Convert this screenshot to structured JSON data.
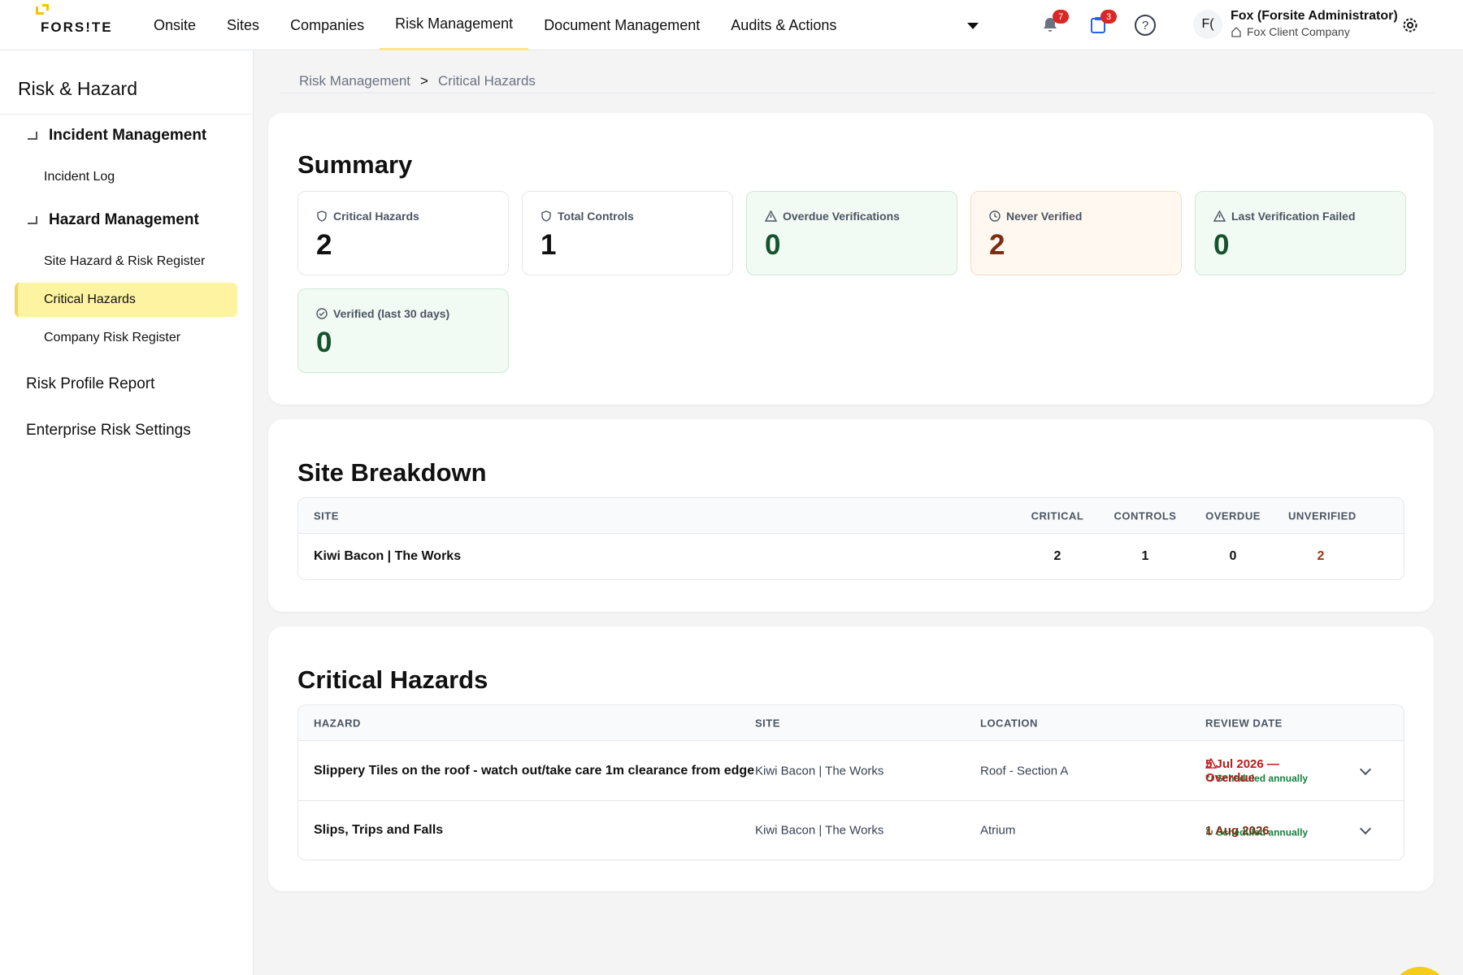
{
  "brand": {
    "logo_text": "FORS!TE"
  },
  "nav": {
    "items": [
      {
        "label": "Onsite"
      },
      {
        "label": "Sites"
      },
      {
        "label": "Companies"
      },
      {
        "label": "Risk Management"
      },
      {
        "label": "Document Management"
      },
      {
        "label": "Audits & Actions"
      }
    ],
    "active": "Risk Management"
  },
  "header": {
    "notifications_count": "7",
    "tasks_count": "3",
    "help_icon": "question-circle-icon",
    "avatar_initials": "F(",
    "user_name": "Fox (Forsite Administrator)",
    "user_company": "Fox Client Company"
  },
  "sidebar": {
    "title": "Risk & Hazard",
    "group_incident": "Incident Management",
    "incident_log": "Incident Log",
    "group_hazard": "Hazard Management",
    "site_hazard_register": "Site Hazard & Risk Register",
    "critical_hazards": "Critical Hazards",
    "company_risk_register": "Company Risk Register",
    "risk_profile_report": "Risk Profile Report",
    "enterprise_risk_settings": "Enterprise Risk Settings"
  },
  "breadcrumb": {
    "parent": "Risk Management",
    "separator": ">",
    "current": "Critical Hazards"
  },
  "summary": {
    "title": "Summary",
    "stats": [
      {
        "label": "Critical Hazards",
        "value": "2",
        "icon": "shield-icon"
      },
      {
        "label": "Total Controls",
        "value": "1",
        "icon": "shield-icon"
      },
      {
        "label": "Overdue Verifications",
        "value": "0",
        "icon": "warning-triangle-icon",
        "tone": "#14532d"
      },
      {
        "label": "Never Verified",
        "value": "2",
        "icon": "clock-icon",
        "tone": "#7c2d12"
      },
      {
        "label": "Last Verification Failed",
        "value": "0",
        "icon": "warning-triangle-icon",
        "tone": "#14532d"
      },
      {
        "label": "Verified (last 30 days)",
        "value": "0",
        "icon": "check-circle-icon",
        "tone": "#14532d"
      }
    ]
  },
  "site_breakdown": {
    "title": "Site Breakdown",
    "columns": {
      "site": "SITE",
      "critical": "CRITICAL",
      "controls": "CONTROLS",
      "overdue": "OVERDUE",
      "unverified": "UNVERIFIED"
    },
    "rows": [
      {
        "site": "Kiwi Bacon | The Works",
        "critical": "2",
        "controls": "1",
        "overdue": "0",
        "unverified": "2"
      }
    ]
  },
  "critical_hazards": {
    "title": "Critical Hazards",
    "columns": {
      "hazard": "HAZARD",
      "site": "SITE",
      "location": "LOCATION",
      "review_date": "REVIEW DATE"
    },
    "rows": [
      {
        "hazard": "Slippery Tiles on the roof - watch out/take care 1m clearance from edge",
        "site": "Kiwi Bacon | The Works",
        "location": "Roof - Section A",
        "review_date": "5 Jul 2026 — Overdue",
        "schedule": "↻ Scheduled annually",
        "status_color": "#b91c1c"
      },
      {
        "hazard": "Slips, Trips and Falls",
        "site": "Kiwi Bacon | The Works",
        "location": "Atrium",
        "review_date": "1 Aug 2026",
        "schedule": "↻ Scheduled annually",
        "status_color": "#7c2d12"
      }
    ]
  },
  "colors": {
    "accent": "#f5cc17",
    "active_bg": "#fef3a0",
    "badge": "#dc2626",
    "overdue": "#b91c1c",
    "unverified": "#9a3412"
  }
}
